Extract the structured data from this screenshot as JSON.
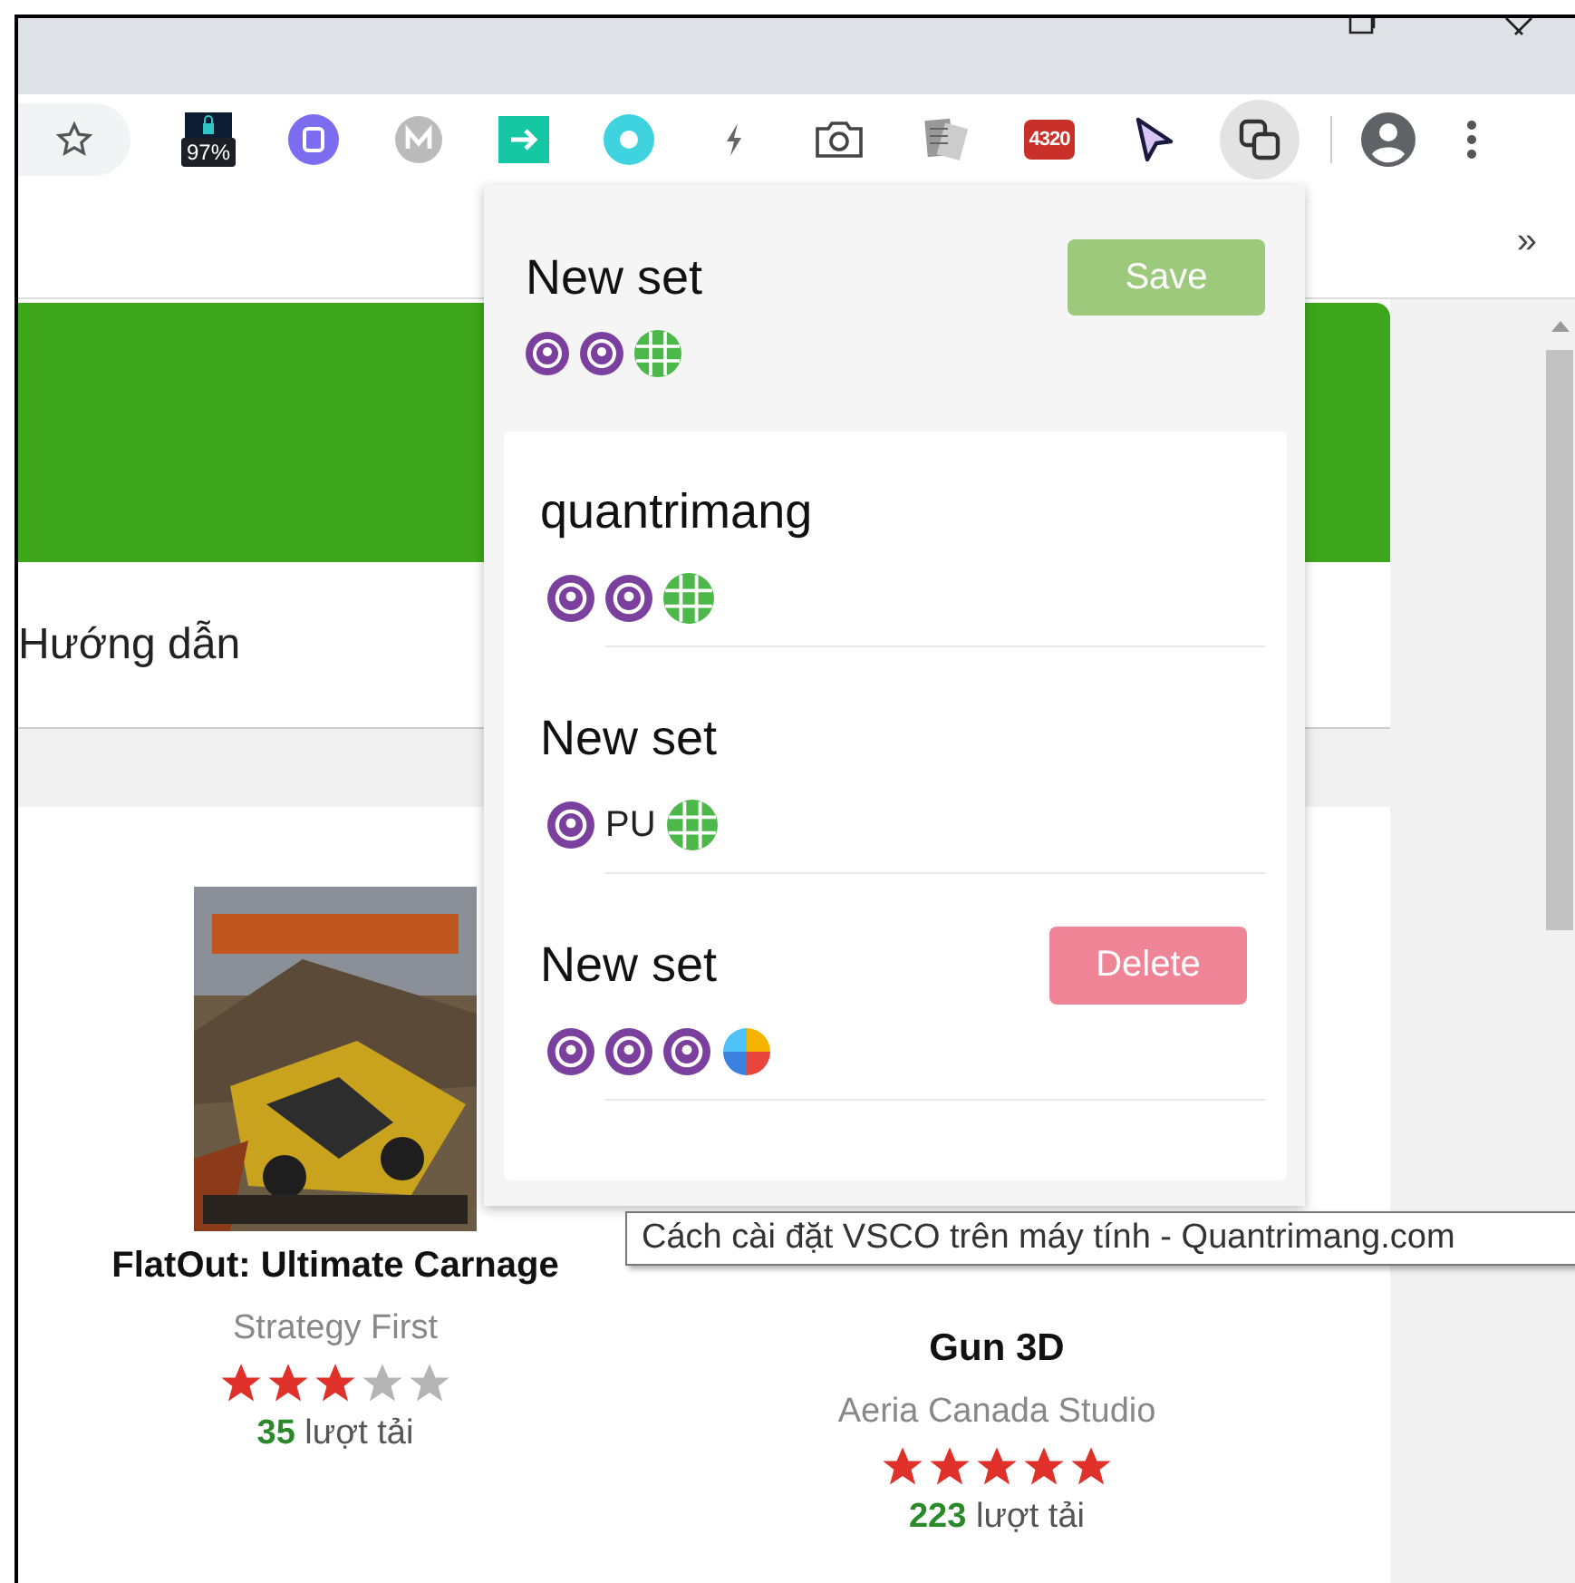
{
  "toolbar": {
    "extensions": [
      {
        "kind": "lock",
        "badge": "97%",
        "active": false
      },
      {
        "kind": "purple",
        "active": false
      },
      {
        "kind": "mega",
        "active": false
      },
      {
        "kind": "arrow",
        "active": false
      },
      {
        "kind": "disc",
        "active": false
      },
      {
        "kind": "bolt",
        "active": false
      },
      {
        "kind": "camera",
        "active": false
      },
      {
        "kind": "notes",
        "active": false
      },
      {
        "kind": "counter",
        "text": "4320",
        "active": false
      },
      {
        "kind": "pointer",
        "active": false
      },
      {
        "kind": "copy",
        "active": true
      }
    ]
  },
  "bookmarks": {
    "overflow": "»"
  },
  "page": {
    "nav_label": "Hướng dẫn",
    "games": [
      {
        "title": "FlatOut: Ultimate Carnage",
        "publisher": "Strategy First",
        "stars": 3,
        "downloads": "35",
        "downloads_label": "lượt tải",
        "kind": "picture"
      },
      {
        "title": "Gun 3D",
        "publisher": "Aeria Canada Studio",
        "stars": 5,
        "downloads": "223",
        "downloads_label": "lượt tải"
      }
    ]
  },
  "popup": {
    "new_set": {
      "name": "New set",
      "save_button": {
        "label": "Save",
        "disabled": true
      },
      "icons": [
        {
          "kind": "q"
        },
        {
          "kind": "q"
        },
        {
          "kind": "grid"
        }
      ]
    },
    "sets": [
      {
        "name": "quantrimang",
        "icons": [
          {
            "kind": "q"
          },
          {
            "kind": "q"
          },
          {
            "kind": "grid"
          }
        ]
      },
      {
        "name": "New set",
        "icons": [
          {
            "kind": "q"
          },
          {
            "kind": "text",
            "text": "PU"
          },
          {
            "kind": "grid"
          }
        ]
      },
      {
        "name": "New set",
        "action": "Delete",
        "icons": [
          {
            "kind": "q"
          },
          {
            "kind": "q"
          },
          {
            "kind": "q"
          },
          {
            "kind": "pinwheel"
          }
        ]
      }
    ]
  },
  "tooltip": "Cách cài đặt VSCO trên máy tính - Quantrimang.com"
}
